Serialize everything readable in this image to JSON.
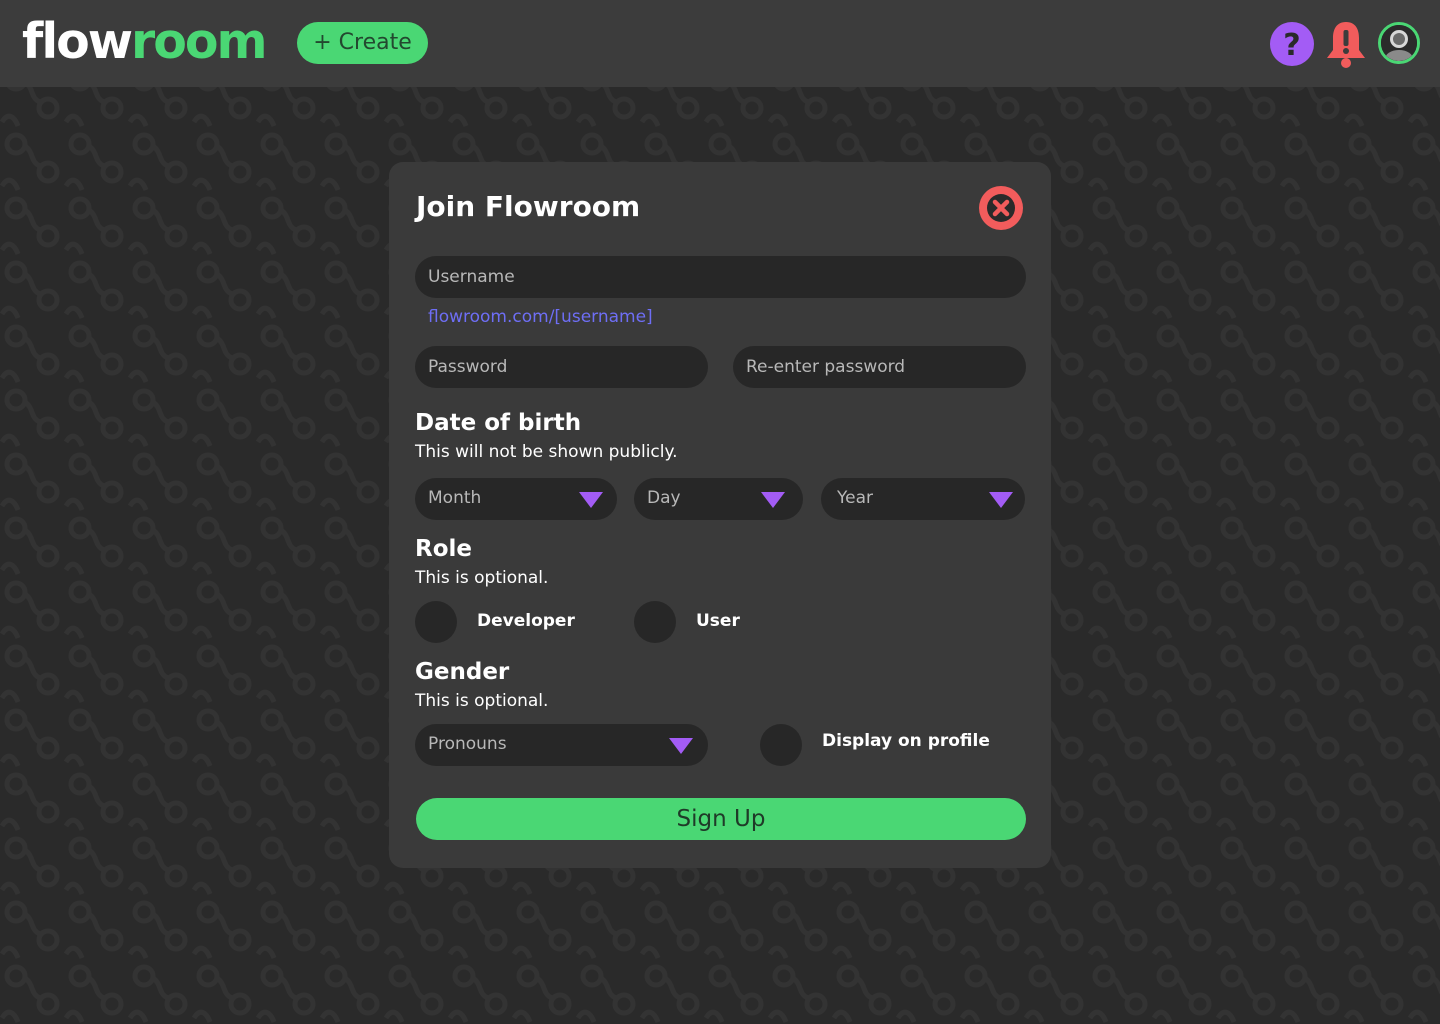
{
  "app": {
    "logo_left": "flow",
    "logo_right": "room",
    "create_label": "+ Create"
  },
  "modal": {
    "title": "Join Flowroom",
    "username_placeholder": "Username",
    "url_hint": "flowroom.com/[username]",
    "password_placeholder": "Password",
    "reenter_placeholder": "Re-enter password",
    "dob": {
      "title": "Date of birth",
      "subtitle": "This will not be shown publicly.",
      "month_label": "Month",
      "day_label": "Day",
      "year_label": "Year"
    },
    "role": {
      "title": "Role",
      "subtitle": "This is optional.",
      "options": [
        "Developer",
        "User"
      ]
    },
    "gender": {
      "title": "Gender",
      "subtitle": "This is optional.",
      "pronouns_label": "Pronouns",
      "display_label": "Display on profile"
    },
    "signup_label": "Sign Up"
  },
  "colors": {
    "accent_green": "#4ad774",
    "accent_purple": "#a35cf5",
    "alert_red": "#f25c5c",
    "link_blue": "#6e6ef5"
  },
  "icons": {
    "help": "help-icon",
    "notifications": "bell-icon",
    "close": "close-icon",
    "dropdown": "triangle-down-icon"
  }
}
